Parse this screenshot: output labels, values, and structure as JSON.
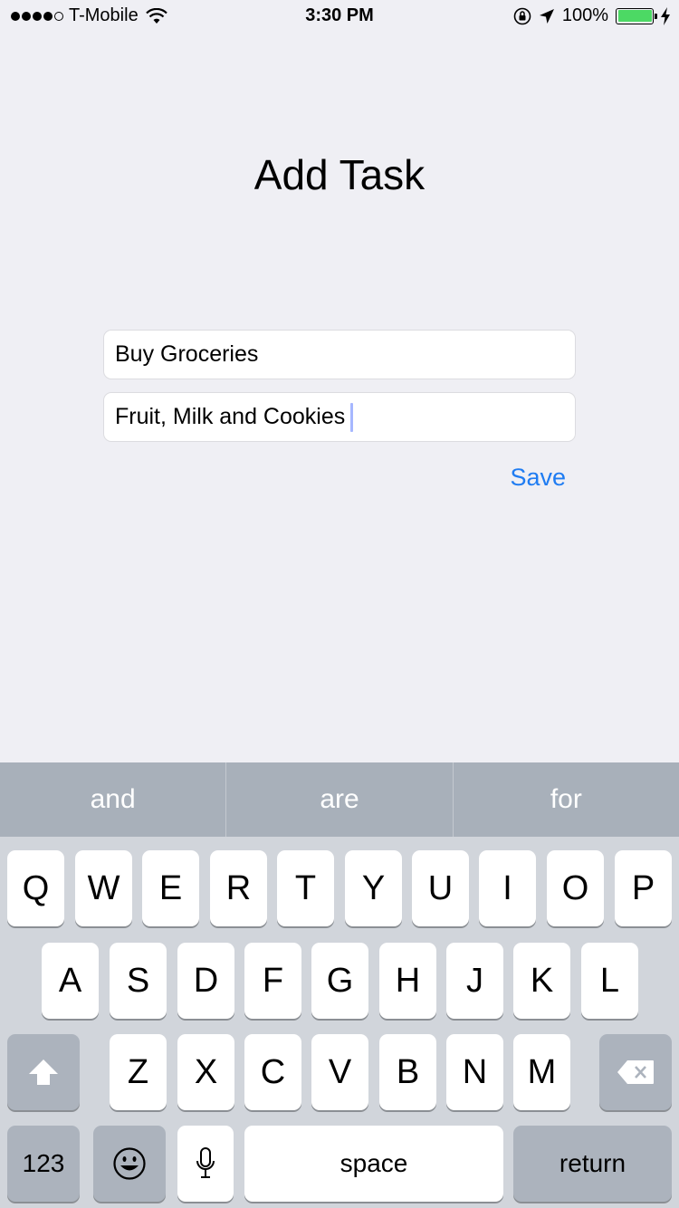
{
  "status_bar": {
    "carrier": "T-Mobile",
    "time": "3:30 PM",
    "battery_percent": "100%",
    "battery_level": 1.0,
    "battery_color": "#4cd964",
    "icons": [
      "signal-icon",
      "wifi-icon",
      "orientation-lock-icon",
      "location-arrow-icon",
      "battery-icon",
      "charging-bolt-icon"
    ]
  },
  "page": {
    "title": "Add Task"
  },
  "form": {
    "title_field_value": "Buy Groceries",
    "notes_field_value": "Fruit, Milk and Cookies",
    "save_label": "Save",
    "accent_color": "#1f7cf2"
  },
  "predictive": [
    "and",
    "are",
    "for"
  ],
  "keyboard": {
    "row1": [
      "Q",
      "W",
      "E",
      "R",
      "T",
      "Y",
      "U",
      "I",
      "O",
      "P"
    ],
    "row2": [
      "A",
      "S",
      "D",
      "F",
      "G",
      "H",
      "J",
      "K",
      "L"
    ],
    "row3": [
      "Z",
      "X",
      "C",
      "V",
      "B",
      "N",
      "M"
    ],
    "numbers_label": "123",
    "space_label": "space",
    "return_label": "return"
  }
}
